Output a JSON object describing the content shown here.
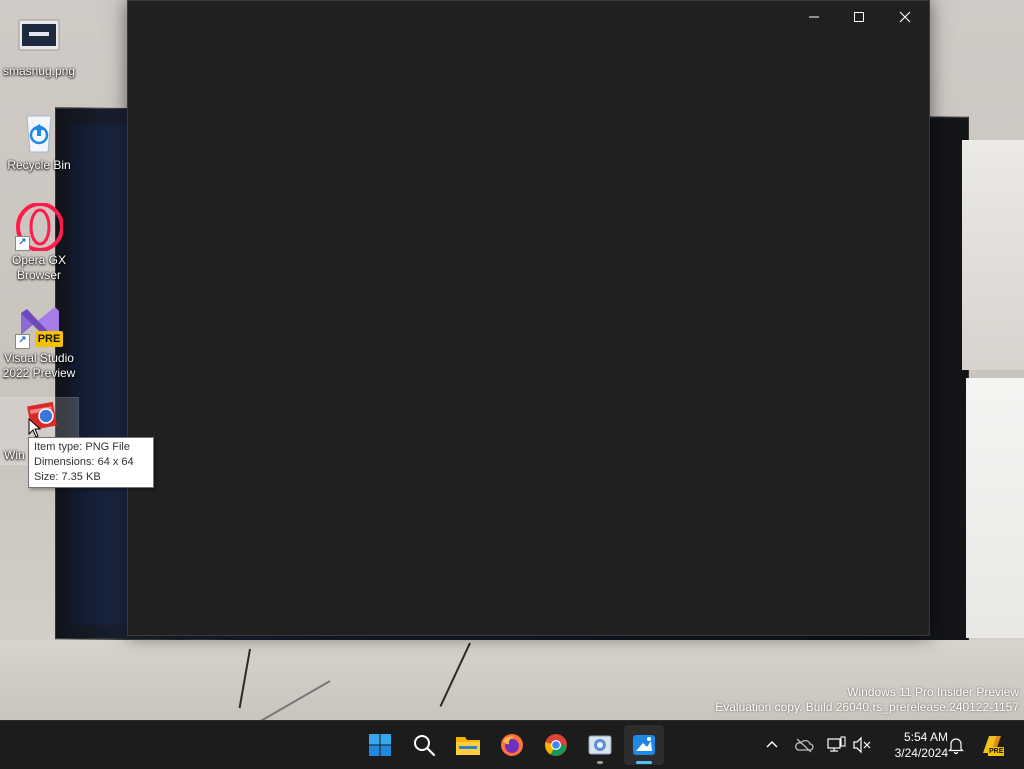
{
  "desktop": {
    "icons": [
      {
        "label": "smasnug.png"
      },
      {
        "label": "Recycle Bin"
      },
      {
        "label": "Opera GX Browser"
      },
      {
        "label": "Visual Studio 2022 Preview"
      },
      {
        "label": "Win"
      }
    ],
    "vs_badge": "PRE"
  },
  "tooltip": {
    "item_type": "Item type: PNG File",
    "dimensions": "Dimensions: 64 x 64",
    "size": "Size: 7.35 KB"
  },
  "window": {
    "background": "#202020"
  },
  "watermark": {
    "line1": "Windows 11 Pro Insider Preview",
    "line2": "Evaluation copy. Build 26040.rs_prerelease.240122-1157"
  },
  "taskbar": {
    "apps": [
      {
        "icon": "windows-start-icon"
      },
      {
        "icon": "search-icon"
      },
      {
        "icon": "file-explorer-icon"
      },
      {
        "icon": "firefox-icon"
      },
      {
        "icon": "chrome-icon"
      },
      {
        "icon": "image-viewer-app-icon"
      },
      {
        "icon": "paint-app-icon"
      }
    ],
    "active_color": "#4cc2ff",
    "clock": {
      "time": "5:54 AM",
      "date": "3/24/2024"
    },
    "copilot_badge": "PRE"
  }
}
